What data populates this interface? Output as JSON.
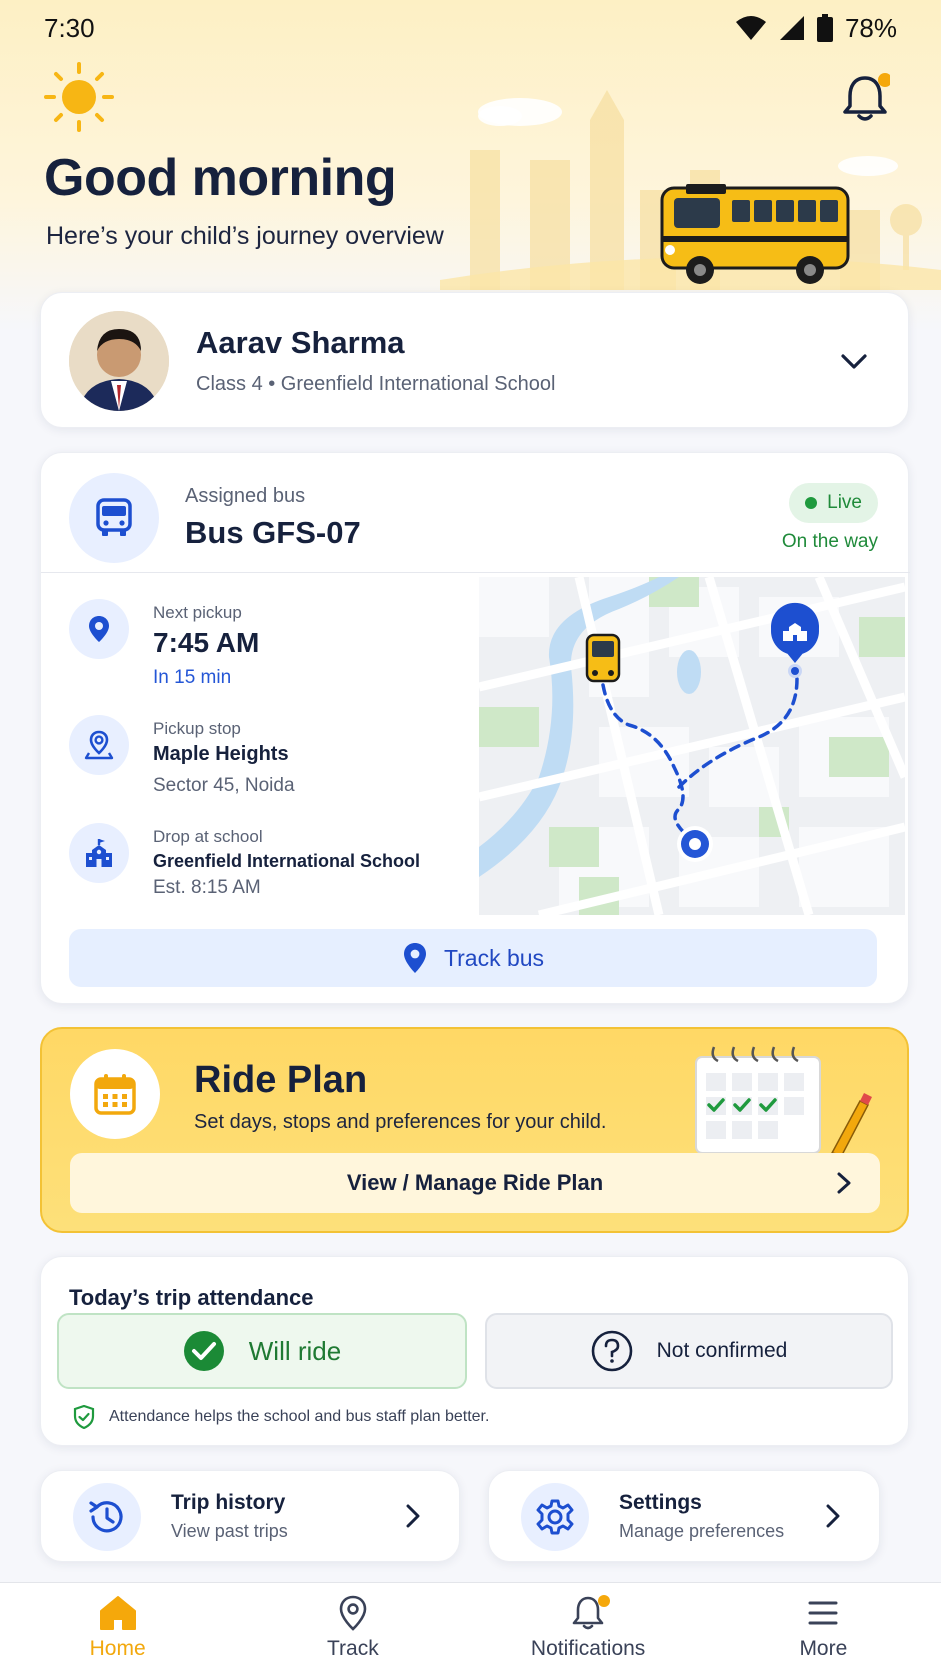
{
  "status_bar": {
    "time": "7:30",
    "battery": "78%"
  },
  "header": {
    "greeting": "Good morning",
    "subtitle": "Here’s your child’s journey overview"
  },
  "child": {
    "name": "Aarav Sharma",
    "meta": "Class 4 • Greenfield International School"
  },
  "bus": {
    "assigned_label": "Assigned bus",
    "number": "Bus GFS-07",
    "live_label": "Live",
    "status": "On the way",
    "next_pickup_label": "Next pickup",
    "next_pickup_time": "7:45 AM",
    "next_pickup_eta": "In 15 min",
    "pickup_stop_label": "Pickup stop",
    "pickup_stop_name": "Maple Heights",
    "pickup_stop_area": "Sector 45, Noida",
    "drop_label": "Drop at school",
    "drop_name": "Greenfield International School",
    "drop_eta": "Est. 8:15 AM",
    "track_button": "Track bus"
  },
  "ride_plan": {
    "title": "Ride Plan",
    "subtitle": "Set days, stops and preferences for your child.",
    "button": "View / Manage Ride Plan"
  },
  "attendance": {
    "title": "Today’s trip attendance",
    "will_ride": "Will ride",
    "not_confirmed": "Not confirmed",
    "note": "Attendance helps the school and bus staff plan better."
  },
  "quick_links": [
    {
      "title": "Trip history",
      "subtitle": "View past trips",
      "icon": "history-icon"
    },
    {
      "title": "Settings",
      "subtitle": "Manage preferences",
      "icon": "gear-icon"
    }
  ],
  "nav": [
    {
      "label": "Home",
      "icon": "home-icon",
      "active": true
    },
    {
      "label": "Track",
      "icon": "location-pin-icon"
    },
    {
      "label": "Notifications",
      "icon": "bell-icon"
    },
    {
      "label": "More",
      "icon": "menu-icon"
    }
  ],
  "colors": {
    "brand_navy": "#16213d",
    "accent_blue": "#2456d6",
    "accent_yellow": "#f5a80b",
    "live_green": "#1f8a3a"
  }
}
